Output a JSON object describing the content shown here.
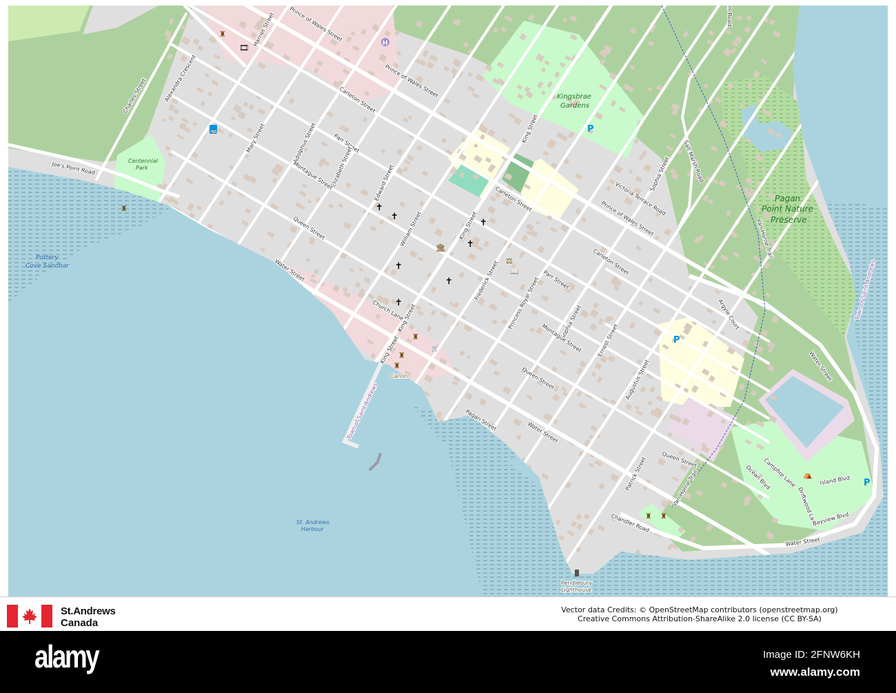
{
  "map": {
    "colors": {
      "water": "#aad3df",
      "land": "#e0dfdf",
      "forest": "#add19e",
      "park": "#c8facc",
      "road": "#ffffff",
      "building": "#d9d0c9",
      "school": "#fffde0",
      "retail": "#f2d9dc",
      "industrial": "#ebdbe8",
      "wetland": "#9fcf84"
    },
    "streets": [
      "Prince of Wales Street",
      "Prince of Wales Street",
      "Prince of Wales Street",
      "Harriet Street",
      "Charles Street",
      "Alexandra Crescent",
      "Carleton Street",
      "Mary Street",
      "Adolphus Street",
      "Parr Street",
      "Elizabeth Street",
      "Montague Street",
      "Joe's Point Road",
      "Edward Street",
      "Queen Street",
      "William Street",
      "King Street",
      "King Street",
      "Carleton Street",
      "Victoria Terrace Road",
      "Sophia Street",
      "Salt Marsh Road",
      "Carleton Street",
      "Water Street",
      "Church Lane",
      "King Street",
      "King Street",
      "Frederick Street",
      "Parr Street",
      "Princess Royal Street",
      "Sophia Street",
      "Montague Street",
      "Ernest Street",
      "Argyle Court",
      "Water Street",
      "Queen Street",
      "Augustus Street",
      "Pagan Street",
      "Water Street",
      "Queen Street",
      "Patrick Street",
      "Van Horne Trail",
      "Van Horne Trail",
      "Campfire Lane",
      "Ocean Blvd",
      "Driftwood Lane",
      "Island Blvd",
      "Bayview Blvd",
      "Water Street",
      "Chandler Road",
      "Town of Saint Andrews",
      "Town of Saint Andrews",
      "m Road"
    ],
    "places": {
      "centennial_1": "Centennial",
      "centennial_2": "Park",
      "pottery_1": "Pottery",
      "pottery_2": "Cove Sandbar",
      "kingsbrae_1": "Kingsbrae",
      "kingsbrae_2": "Gardens",
      "pagan_1": "Pagan",
      "pagan_2": "Point Nature",
      "pagan_3": "Preserve",
      "harbour_1": "St. Andrews",
      "harbour_2": "Harbour",
      "canon": "Canon",
      "lighthouse_1": "Pendlebury",
      "lighthouse_2": "Lighthouse"
    },
    "icons": {
      "church": "✝",
      "parking": "P",
      "hospital": "H",
      "bus": "🚌",
      "museum": "🏛",
      "monument": "♜",
      "library": "📖",
      "court": "⚖",
      "camp": "⛺",
      "cinema": "🎞",
      "shop": "🛒"
    }
  },
  "footer": {
    "title_line1": "St.Andrews",
    "title_line2": "Canada",
    "credits_line1": "Vector data Credits: © OpenStreetMap contributors (openstreetmap.org)",
    "credits_line2": "Creative Commons Attribution-ShareAlike 2.0 license (CC BY-SA)"
  },
  "watermark": {
    "logo": "alamy",
    "image_id": "Image ID: 2FNW6KH",
    "site": "www.alamy.com"
  }
}
